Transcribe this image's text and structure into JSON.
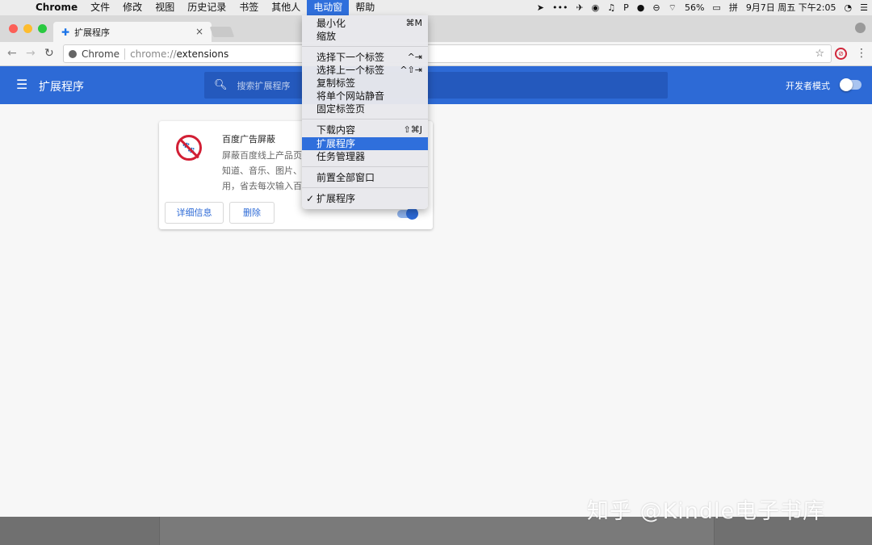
{
  "menubar": {
    "apple": "",
    "app": "Chrome",
    "items": [
      "文件",
      "修改",
      "视图",
      "历史记录",
      "书签",
      "其他人",
      "电动窗",
      "帮助"
    ],
    "status": {
      "battery": "56%",
      "datetime": "9月7日 周五 下午2:05"
    }
  },
  "browser": {
    "tab_title": "扩展程序",
    "omnibox": {
      "origin": "Chrome",
      "scheme": "chrome://",
      "path": "extensions"
    }
  },
  "extensions_page": {
    "title": "扩展程序",
    "search_placeholder": "搜索扩展程序",
    "dev_mode_label": "开发者模式",
    "dev_mode_on": false
  },
  "extension_card": {
    "name": "百度广告屏蔽",
    "description_lines": [
      "屏蔽百度线上产品页",
      "知道、音乐、图片、",
      "用，省去每次输入百"
    ],
    "details_label": "详细信息",
    "remove_label": "删除",
    "enabled": true
  },
  "window_menu": {
    "items": [
      {
        "label": "最小化",
        "shortcut": "⌘M"
      },
      {
        "label": "缩放",
        "shortcut": ""
      },
      {
        "label": "选择下一个标签",
        "shortcut": "^⇥"
      },
      {
        "label": "选择上一个标签",
        "shortcut": "^⇧⇥"
      },
      {
        "label": "复制标签",
        "shortcut": ""
      },
      {
        "label": "将单个网站静音",
        "shortcut": ""
      },
      {
        "label": "固定标签页",
        "shortcut": ""
      },
      {
        "label": "下载内容",
        "shortcut": "⇧⌘J"
      },
      {
        "label": "扩展程序",
        "shortcut": ""
      },
      {
        "label": "任务管理器",
        "shortcut": ""
      },
      {
        "label": "前置全部窗口",
        "shortcut": ""
      },
      {
        "label": "扩展程序",
        "shortcut": "",
        "checked": true
      }
    ]
  },
  "watermark": "知乎 @Kindle电子书库"
}
